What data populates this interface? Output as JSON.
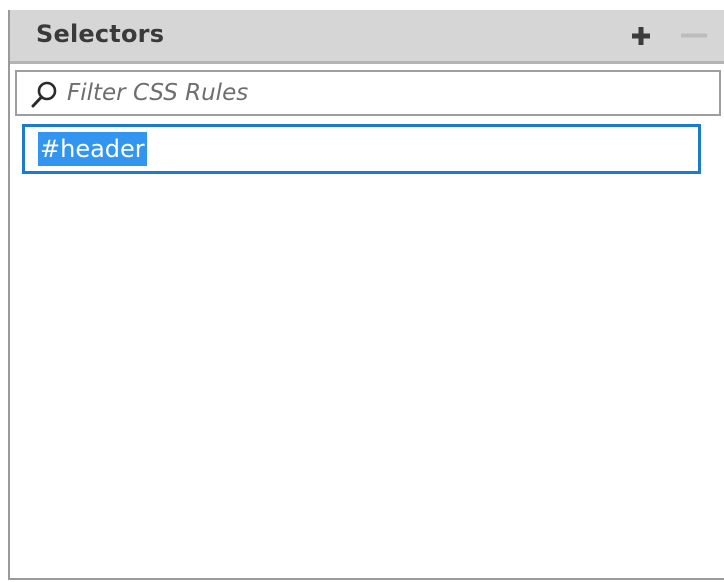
{
  "panel": {
    "title": "Selectors",
    "add_button": {
      "icon": "plus-icon",
      "label": "+"
    },
    "remove_button": {
      "icon": "minus-icon",
      "label": "—",
      "enabled": false
    }
  },
  "filter": {
    "placeholder": "Filter CSS Rules",
    "value": "",
    "icon": "search-icon"
  },
  "selectors": {
    "items": [
      {
        "label": "#header",
        "selected": true,
        "editing": true
      }
    ]
  },
  "colors": {
    "header_bg": "#d6d6d6",
    "selection_blue": "#3296f0",
    "edit_border": "#1d7acc"
  }
}
